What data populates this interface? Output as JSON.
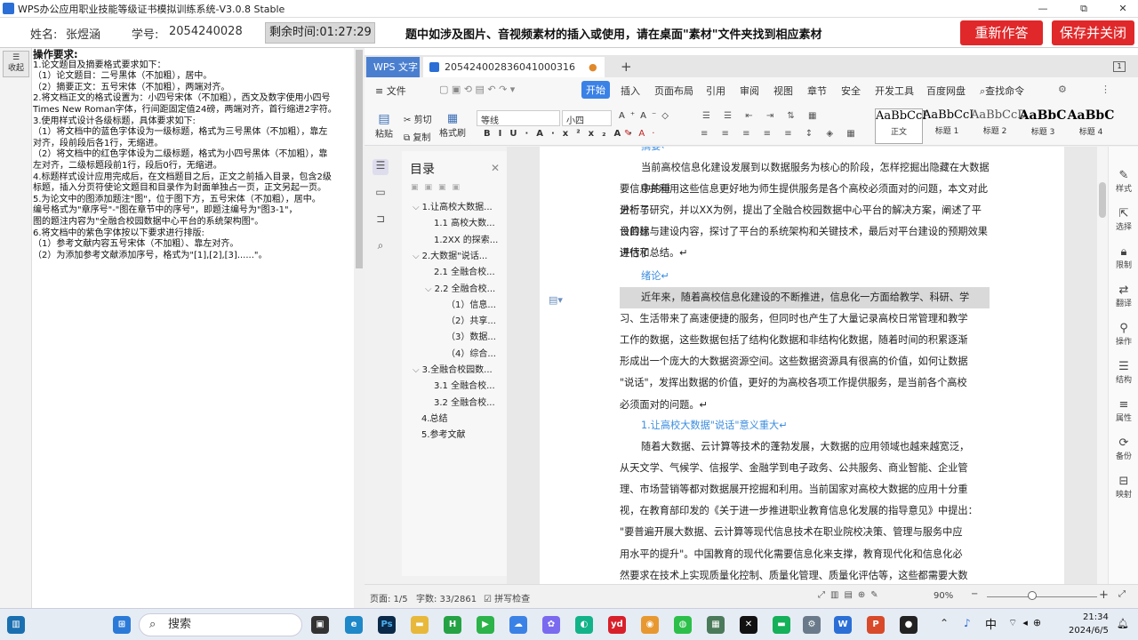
{
  "window": {
    "title": "WPS办公应用职业技能等级证书模拟训练系统-V3.0.8 Stable",
    "min": "—",
    "max": "⧉",
    "close": "✕"
  },
  "info": {
    "name_label": "姓名:",
    "name": "张煜涵",
    "id_label": "学号:",
    "id": "2054240028",
    "time_label": "剩余时间:",
    "time": "01:27:29",
    "notice": "题中如涉及图片、音视频素材的插入或使用，请在桌面\"素材\"文件夹找到相应素材",
    "redo": "重新作答",
    "save": "保存并关闭"
  },
  "sidebar": {
    "collapse": "收起"
  },
  "instructions": {
    "heading": "操作要求:",
    "lines": [
      "1.论文题目及摘要格式要求如下：",
      "（1）论文题目：二号黑体（不加粗），居中。",
      "（2）摘要正文：五号宋体（不加粗），两端对齐。",
      "2.将文档正文的格式设置为：小四号宋体（不加粗），西文及数字使用小四号",
      "Times New Roman字体，行间距固定值24磅，两端对齐，首行缩进2字符。",
      "3.使用样式设计各级标题，具体要求如下:",
      "（1）将文档中的蓝色字体设为一级标题，格式为三号黑体（不加粗），靠左",
      "对齐，段前段后各1行，无缩进。",
      "（2）将文档中的红色字体设为二级标题，格式为小四号黑体（不加粗），靠",
      "左对齐，二级标题段前1行，段后0行，无缩进。",
      "4.标题样式设计应用完成后，在文档题目之后，正文之前插入目录，包含2级",
      "标题，插入分页符使论文题目和目录作为封面单独占一页，正文另起一页。",
      "5.为论文中的图添加题注\"图\"，位于图下方，五号宋体（不加粗），居中。",
      "编号格式为\"章序号\"-\"图在章节中的序号\"，即题注编号为\"图3-1\"，",
      "图的题注内容为\"全融合校园数据中心平台的系统架构图\"。",
      "6.将文档中的紫色字体按以下要求进行排版:",
      "（1）参考文献内容五号宋体（不加粗）、靠左对齐。",
      "（2）为添加参考文献添加序号，格式为\"[1],[2],[3]......\"。"
    ]
  },
  "wps": {
    "tabs": [
      "WPS 文字",
      "2054240028360410003​16",
      "+"
    ],
    "menu": [
      "≡ 文件",
      "开始",
      "插入",
      "页面布局",
      "引用",
      "审阅",
      "视图",
      "章节",
      "安全",
      "开发工具",
      "百度网盘",
      "查找命令"
    ],
    "ribbon": {
      "paste": "粘贴",
      "cut": "剪切",
      "copy": "复制",
      "format_painter": "格式刷",
      "font": "等线",
      "size": "小四",
      "styles": [
        {
          "preview": "AaBbCcI",
          "name": "正文"
        },
        {
          "preview": "AaBbCcI",
          "name": "标题 1"
        },
        {
          "preview": "AaBbCcD",
          "name": "标题 2"
        },
        {
          "preview": "AaBbC",
          "name": "标题 3"
        },
        {
          "preview": "AaBbC",
          "name": "标题 4"
        }
      ]
    },
    "toc": {
      "title": "目录",
      "items": [
        {
          "t": "1.让高校大数据...",
          "lv": 1
        },
        {
          "t": "1.1 高校大数...",
          "lv": 2
        },
        {
          "t": "1.2XX 的探索...",
          "lv": 2
        },
        {
          "t": "2.大数据\"说话...",
          "lv": 1
        },
        {
          "t": "2.1 全融合校...",
          "lv": 2
        },
        {
          "t": "2.2 全融合校...",
          "lv": 2
        },
        {
          "t": "（1）信息...",
          "lv": 3
        },
        {
          "t": "（2）共享...",
          "lv": 3
        },
        {
          "t": "（3）数据...",
          "lv": 3
        },
        {
          "t": "（4）综合...",
          "lv": 3
        },
        {
          "t": "3.全融合校园数...",
          "lv": 1
        },
        {
          "t": "3.1 全融合校...",
          "lv": 2
        },
        {
          "t": "3.2 全融合校...",
          "lv": 2
        },
        {
          "t": "4.总结",
          "lv": 1
        },
        {
          "t": "5.参考文献",
          "lv": 1
        }
      ]
    },
    "doc": {
      "p0": "摘要↵",
      "p1": [
        "当前高校信息化建设发展到以数据服务为核心的阶段，怎样挖掘出隐藏在大数据中的重",
        "要信息并利用这些信息更好地为师生提供服务是各个高校必须面对的问题，本文对此进行了",
        "分析与研究，并以XX为例，提出了全融合校园数据中心平台的解决方案，阐述了平台的建",
        "设目标与建设内容，探讨了平台的系统架构和关键技术，最后对平台建设的预期效果进行了",
        "评估和总结。↵"
      ],
      "h1": "绪论↵",
      "p2": [
        "近年来，随着高校信息化建设的不断推进，信息化一方面给教学、科研、学",
        "习、生活带来了高速便捷的服务，但同时也产生了大量记录高校日常管理和教学",
        "工作的数据，这些数据包括了结构化数据和非结构化数据，随着时间的积累逐渐",
        "形成出一个庞大的大数据资源空间。这些数据资源具有很高的价值，如何让数据",
        "\"说话\"，发挥出数据的价值，更好的为高校各项工作提供服务，是当前各个高校",
        "必须面对的问题。↵"
      ],
      "h2": "1.让高校大数据\"说话\"意义重大↵",
      "p3": [
        "随着大数据、云计算等技术的蓬勃发展，大数据的应用领域也越来越宽泛，",
        "从天文学、气候学、信报学、金融学到电子政务、公共服务、商业智能、企业管",
        "理、市场营销等都对数据展开挖掘和利用。当前国家对高校大数据的应用十分重",
        "视，在教育部印发的《关于进一步推进职业教育信息化发展的指导意见》中提出：",
        "\"要普遍开展大数据、云计算等现代信息技术在职业院校决策、管理与服务中应",
        "用水平的提升\"。中国教育的现代化需要信息化来支撑，教育现代化和信息化必",
        "然要求在技术上实现质量化控制、质量化管理、质量化评估等，这些都需要大数"
      ]
    },
    "right": [
      "样式",
      "选择",
      "限制",
      "翻译",
      "操作",
      "结构",
      "属性",
      "备份",
      "映射"
    ],
    "status": {
      "page": "页面: 1/5",
      "words": "字数: 33/2861",
      "spell": "拼写检查",
      "zoom": "90%"
    }
  },
  "taskbar": {
    "search": "搜索",
    "ime": "中",
    "time": "21:34",
    "date": "2024/6/5"
  }
}
